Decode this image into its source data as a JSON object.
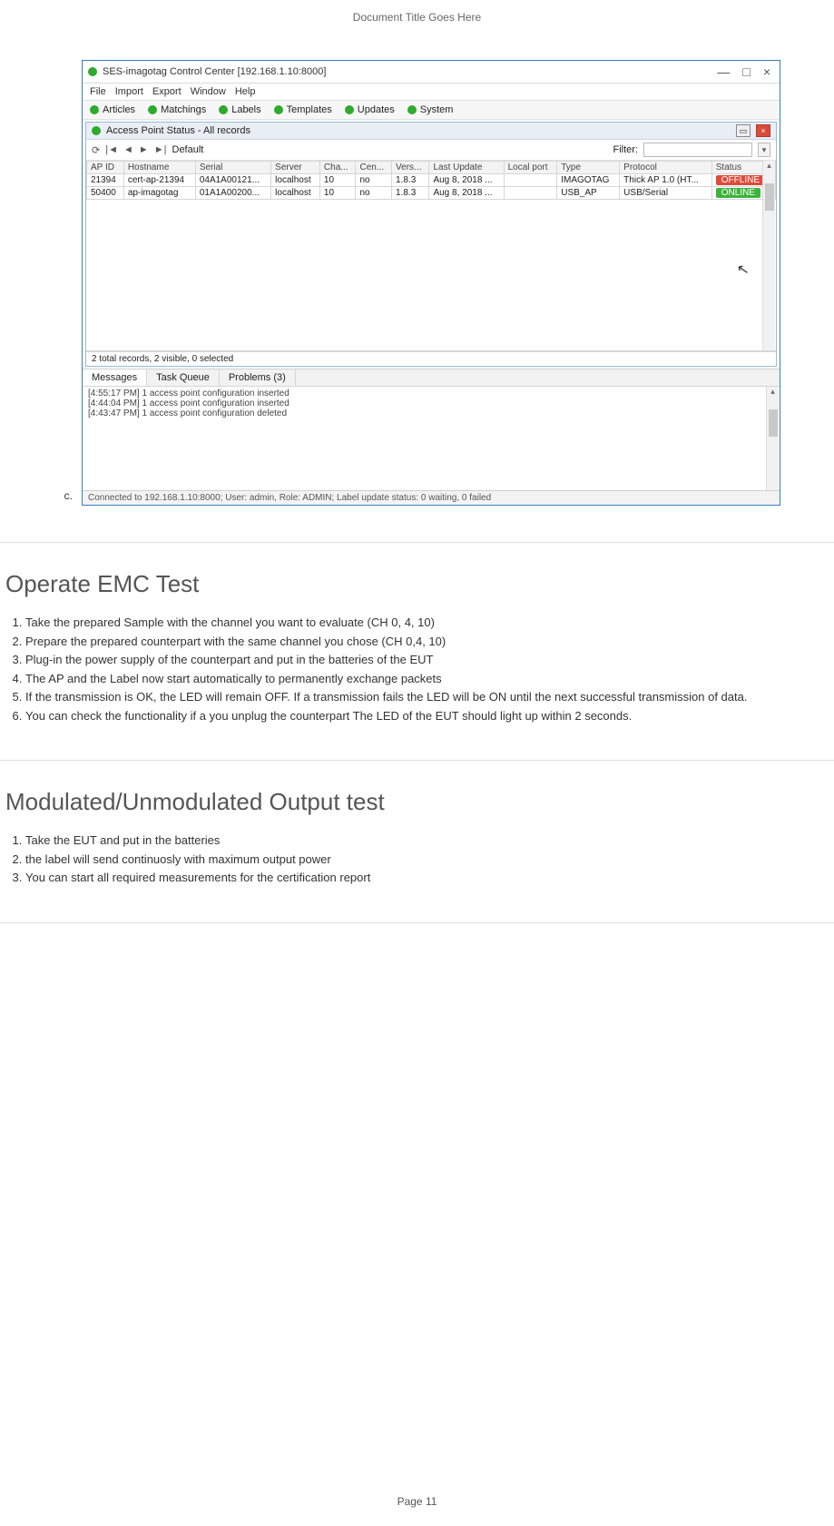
{
  "doc": {
    "header": "Document Title Goes Here",
    "footer": "Page 11",
    "bullet": "c."
  },
  "win": {
    "title": "SES-imagotag Control Center [192.168.1.10:8000]",
    "sys": {
      "min": "—",
      "max": "□",
      "close": "×"
    },
    "menu": [
      "File",
      "Import",
      "Export",
      "Window",
      "Help"
    ],
    "navtabs": [
      "Articles",
      "Matchings",
      "Labels",
      "Templates",
      "Updates",
      "System"
    ],
    "sub_title": "Access Point Status - All records",
    "toolbar": {
      "refresh": "⟳",
      "first": "|◄",
      "prev": "◄",
      "next": "►",
      "last": "►|",
      "scheme": "Default",
      "filter_label": "Filter:"
    },
    "columns": [
      "AP ID",
      "Hostname",
      "Serial",
      "Server",
      "Cha...",
      "Cen...",
      "Vers...",
      "Last Update",
      "Local port",
      "Type",
      "Protocol",
      "Status"
    ],
    "rows": [
      {
        "apid": "21394",
        "host": "cert-ap-21394",
        "serial": "04A1A00121...",
        "server": "localhost",
        "cha": "10",
        "cen": "no",
        "ver": "1.8.3",
        "upd": "Aug 8, 2018 ...",
        "port": "",
        "type": "IMAGOTAG",
        "proto": "Thick AP 1.0 (HT...",
        "status": "OFFLINE",
        "cls": "offline"
      },
      {
        "apid": "50400",
        "host": "ap-imagotag",
        "serial": "01A1A00200...",
        "server": "localhost",
        "cha": "10",
        "cen": "no",
        "ver": "1.8.3",
        "upd": "Aug 8, 2018 ...",
        "port": "",
        "type": "USB_AP",
        "proto": "USB/Serial",
        "status": "ONLINE",
        "cls": "online"
      }
    ],
    "grid_status": "2 total records, 2 visible, 0 selected",
    "msg_tabs": [
      "Messages",
      "Task Queue",
      "Problems (3)"
    ],
    "messages": [
      "[4:55:17 PM] 1 access point configuration inserted",
      "[4:44:04 PM] 1 access point configuration inserted",
      "[4:43:47 PM] 1 access point configuration deleted"
    ],
    "statusbar": "Connected to 192.168.1.10:8000; User: admin, Role: ADMIN; Label update status: 0 waiting, 0 failed"
  },
  "sections": {
    "emc": {
      "title": "Operate EMC Test",
      "steps": [
        "Take the prepared Sample with the channel you want to evaluate (CH 0, 4, 10)",
        "Prepare the prepared counterpart with the same channel you chose (CH 0,4, 10)",
        "Plug-in the power supply of the counterpart and put in the batteries of the EUT",
        "The AP and the Label now start automatically to permanently exchange packets",
        "If the transmission is OK, the LED will remain OFF. If a transmission fails the LED will be ON until the next successful transmission of data.",
        "You can check the functionality if a you unplug the counterpart  The LED of the EUT should light up within 2 seconds."
      ]
    },
    "mod": {
      "title": "Modulated/Unmodulated Output test",
      "steps": [
        "Take the EUT and put in the batteries",
        "the label will send continuosly with maximum output power",
        "You can start all required measurements for the certification report"
      ]
    }
  }
}
